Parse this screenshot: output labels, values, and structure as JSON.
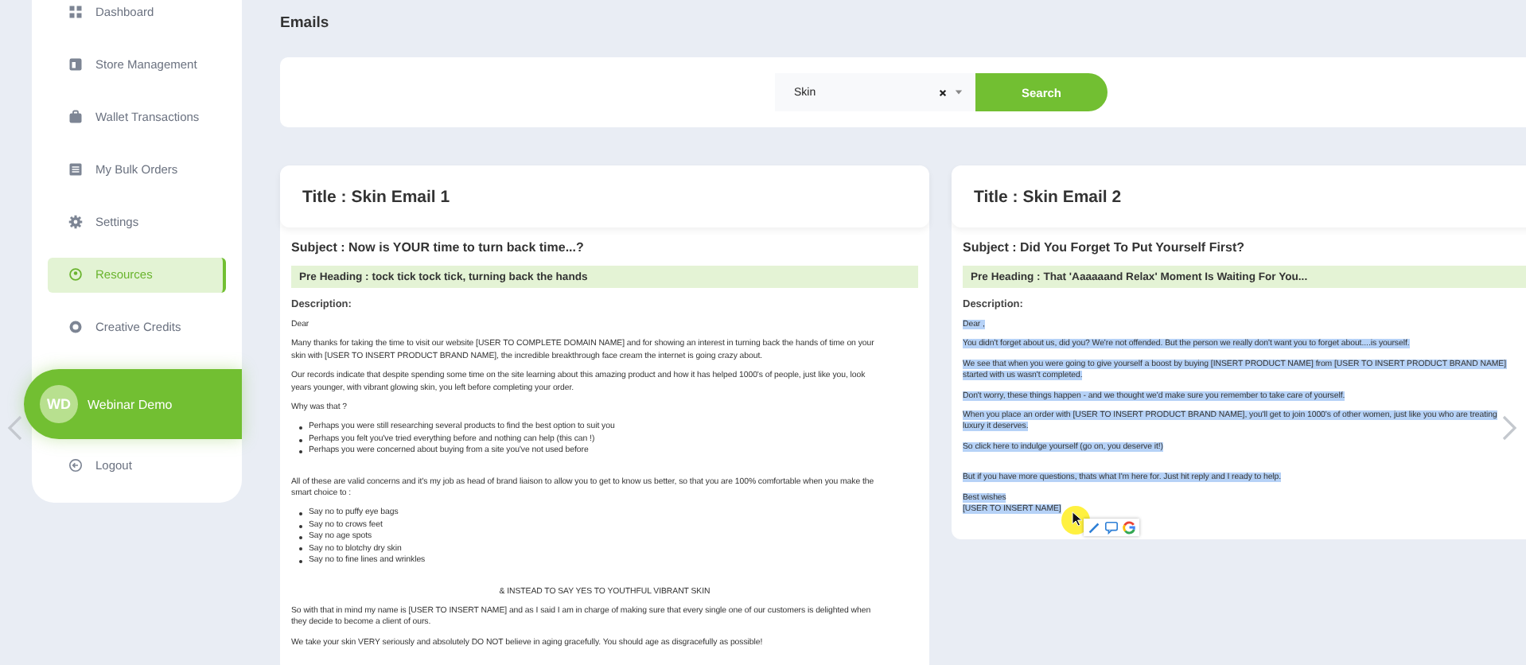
{
  "sidebar": {
    "items": [
      {
        "label": "Dashboard",
        "selected": false
      },
      {
        "label": "Store Management",
        "selected": false
      },
      {
        "label": "Wallet Transactions",
        "selected": false
      },
      {
        "label": "My Bulk Orders",
        "selected": false
      },
      {
        "label": "Settings",
        "selected": false
      },
      {
        "label": "Resources",
        "selected": true
      },
      {
        "label": "Creative Credits",
        "selected": false
      }
    ],
    "profile": {
      "initials": "WD",
      "name": "Webinar Demo"
    },
    "logout": "Logout"
  },
  "page_title": "Emails",
  "search": {
    "value": "Skin",
    "button": "Search"
  },
  "emails": [
    {
      "title": "Title : Skin Email 1",
      "subject": "Subject : Now is YOUR time to turn back time...?",
      "pre_heading": "Pre Heading : tock tick tock tick, turning back the hands",
      "description_label": "Description:",
      "body_selected": false,
      "body": [
        {
          "kind": "p",
          "lines": [
            "Dear"
          ]
        },
        {
          "kind": "p",
          "lines": [
            "Many thanks for taking the time to visit our website [USER TO COMPLETE DOMAIN NAME] and for showing an interest in turning back the hands of time on your",
            "skin with [USER TO INSERT PRODUCT BRAND NAME],  the incredible breakthrough face cream the internet is going crazy about."
          ]
        },
        {
          "kind": "p",
          "lines": [
            "Our records indicate that despite spending some time on the site learning about this amazing product and how it has helped 1000's of people, just like you, look",
            "years younger, with vibrant glowing skin, you left before completing your order."
          ]
        },
        {
          "kind": "p",
          "lines": [
            "Why was that ?"
          ]
        },
        {
          "kind": "list",
          "lines": [
            "Perhaps you were still researching several products to find the best option to suit you",
            "Perhaps you felt you've tried everything before and nothing can help (this can !)",
            "Perhaps you were concerned about buying from a site you've not used before"
          ]
        },
        {
          "kind": "gap"
        },
        {
          "kind": "p",
          "lines": [
            "All of these are valid concerns and it's my job as head of brand liaison to allow you to get to know us better, so that you are 100% comfortable when you make the",
            "smart choice to :"
          ]
        },
        {
          "kind": "list",
          "lines": [
            "Say no to puffy eye bags",
            "Say no to crows feet",
            "Say no age spots",
            "Say no to blotchy dry skin",
            "Say no to fine lines and wrinkles"
          ]
        },
        {
          "kind": "gap"
        },
        {
          "kind": "center",
          "lines": [
            "& INSTEAD TO SAY YES TO YOUTHFUL VIBRANT SKIN"
          ]
        },
        {
          "kind": "p",
          "lines": [
            "So with that in mind my name is [USER TO INSERT NAME]  and as I said I am in charge of making sure that every single one of our customers is delighted when",
            "they decide to become a client of ours."
          ]
        },
        {
          "kind": "p",
          "lines": [
            "We take your skin VERY seriously and absolutely DO NOT believe in aging gracefully.  You should age as disgracefully as possible!"
          ]
        }
      ]
    },
    {
      "title": "Title : Skin Email 2",
      "subject": "Subject : Did You Forget To Put Yourself First?",
      "pre_heading": "Pre Heading : That 'Aaaaaand Relax' Moment Is Waiting For You...",
      "description_label": "Description:",
      "body_selected": true,
      "body": [
        {
          "kind": "p",
          "lines": [
            "Dear ,"
          ]
        },
        {
          "kind": "p",
          "lines": [
            "You didn't forget about us, did you? We're not offended. But the person we really don't want you to forget about....is yourself."
          ]
        },
        {
          "kind": "p",
          "lines": [
            "We see that when you were going to give yourself a boost by buying [INSERT PRODUCT NAME] from [USER TO INSERT PRODUCT BRAND NAME]",
            "started with us wasn't completed."
          ]
        },
        {
          "kind": "p",
          "lines": [
            "Don't worry, these things happen - and we thought we'd make sure you remember to take care of yourself."
          ]
        },
        {
          "kind": "p",
          "lines": [
            "When you place an order with [USER TO INSERT PRODUCT BRAND NAME], you'll get to join 1000's of other women, just like you who are treating",
            "luxury it deserves."
          ]
        },
        {
          "kind": "p",
          "lines": [
            "So click here to indulge yourself (go on, you deserve it!)"
          ]
        },
        {
          "kind": "gap"
        },
        {
          "kind": "p",
          "lines": [
            "But if you have more questions, thats what I'm here for.  Just hit reply and I ready to help."
          ]
        },
        {
          "kind": "p",
          "lines": [
            "Best wishes",
            "[USER TO INSERT NAME]"
          ]
        }
      ]
    }
  ]
}
